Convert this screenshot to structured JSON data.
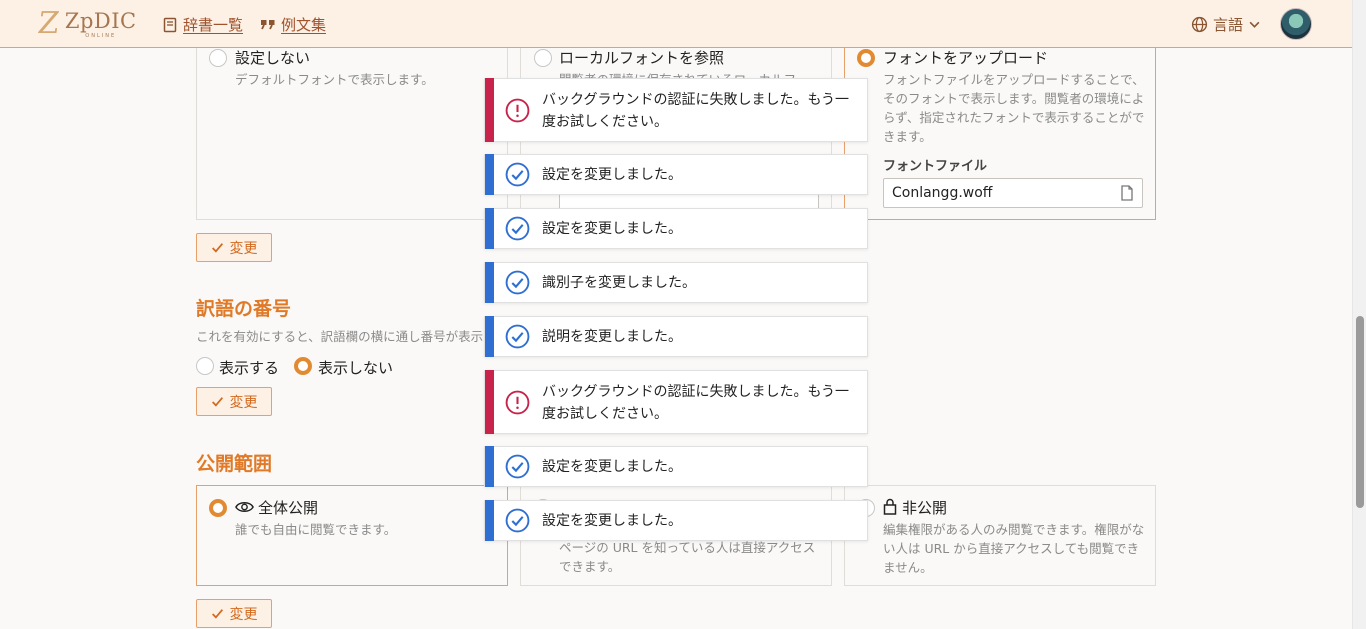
{
  "header": {
    "logo_main": "ZpDIC",
    "logo_sub": "ONLINE",
    "nav_dictionaries": "辞書一覧",
    "nav_examples": "例文集",
    "language": "言語"
  },
  "font_section": {
    "option_none": {
      "title": "設定しない",
      "desc": "デフォルトフォントで表示します。"
    },
    "option_local": {
      "title": "ローカルフォントを参照",
      "desc": "閲覧者の環境に保存されているローカルフ"
    },
    "option_upload": {
      "title": "フォントをアップロード",
      "desc": "フォントファイルをアップロードすることで、そのフォントで表示します。閲覧者の環境によらず、指定されたフォントで表示することができます。",
      "file_label": "フォントファイル",
      "file_value": "Conlangg.woff"
    },
    "selected": "upload",
    "change_label": "変更"
  },
  "equivalent_numbers": {
    "title": "訳語の番号",
    "desc": "これを有効にすると、訳語欄の横に通し番号が表示",
    "option_show": "表示する",
    "option_hide": "表示しない",
    "selected": "hide",
    "change_label": "変更"
  },
  "visibility": {
    "title": "公開範囲",
    "option_public": {
      "title": "全体公開",
      "desc": "誰でも自由に閲覧できます。"
    },
    "option_unlisted": {
      "desc": "ページの URL を知っている人は直接アクセスできます。"
    },
    "option_private": {
      "title": "非公開",
      "desc": "編集権限がある人のみ閲覧できます。権限がない人は URL から直接アクセスしても閲覧できません。"
    },
    "selected": "public",
    "change_label": "変更"
  },
  "toasts": [
    {
      "type": "error",
      "message": "バックグラウンドの認証に失敗しました。もう一度お試しください。"
    },
    {
      "type": "success",
      "message": "設定を変更しました。"
    },
    {
      "type": "success",
      "message": "設定を変更しました。"
    },
    {
      "type": "success",
      "message": "識別子を変更しました。"
    },
    {
      "type": "success",
      "message": "説明を変更しました。"
    },
    {
      "type": "error",
      "message": "バックグラウンドの認証に失敗しました。もう一度お試しください。"
    },
    {
      "type": "success",
      "message": "設定を変更しました。"
    },
    {
      "type": "success",
      "message": "設定を変更しました。"
    }
  ],
  "colors": {
    "accent": "#e28a32",
    "success": "#2e6fd1",
    "error": "#c8234a",
    "header_bg": "#fdf1e5"
  }
}
